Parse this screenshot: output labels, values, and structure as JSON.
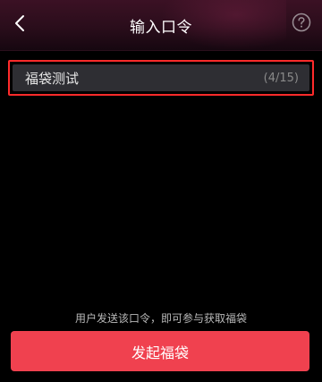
{
  "header": {
    "title": "输入口令",
    "back_icon": "chevron-left-icon",
    "help_icon": "question-circle-icon"
  },
  "input": {
    "value": "福袋测试",
    "counter": "(4/15)"
  },
  "hint": "用户发送该口令，即可参与获取福袋",
  "primary_button": {
    "label": "发起福袋"
  },
  "colors": {
    "background": "#000000",
    "focus_border": "#ff2a2a",
    "input_background": "#2e2e33",
    "button": "#f0414f"
  }
}
